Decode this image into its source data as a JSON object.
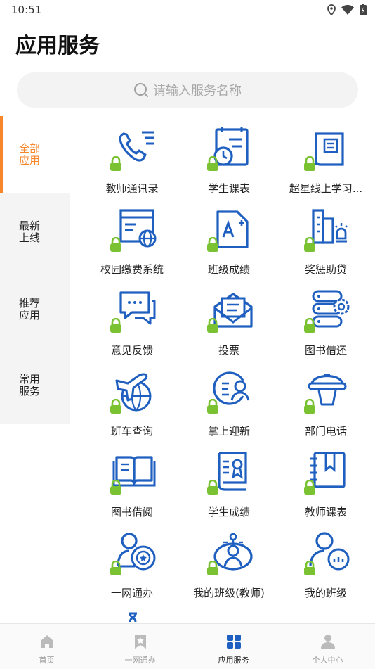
{
  "status": {
    "time": "10:51",
    "icons": [
      "location-icon",
      "wifi-icon",
      "battery-icon"
    ]
  },
  "page": {
    "title": "应用服务"
  },
  "search": {
    "placeholder": "请输入服务名称"
  },
  "sidebar": {
    "items": [
      {
        "label": "全部应用",
        "active": true
      },
      {
        "label": "最新上线",
        "active": false
      },
      {
        "label": "推荐应用",
        "active": false
      },
      {
        "label": "常用服务",
        "active": false
      }
    ]
  },
  "apps": [
    {
      "label": "教师通讯录",
      "icon": "phone-contacts-icon"
    },
    {
      "label": "学生课表",
      "icon": "calendar-clock-icon"
    },
    {
      "label": "超星线上学习...",
      "icon": "book-reader-icon"
    },
    {
      "label": "校园缴费系统",
      "icon": "web-payment-icon"
    },
    {
      "label": "班级成绩",
      "icon": "grade-document-icon"
    },
    {
      "label": "奖惩助贷",
      "icon": "award-building-icon"
    },
    {
      "label": "意见反馈",
      "icon": "chat-bubbles-icon"
    },
    {
      "label": "投票",
      "icon": "envelope-vote-icon"
    },
    {
      "label": "图书借还",
      "icon": "database-gear-icon"
    },
    {
      "label": "班车查询",
      "icon": "airplane-globe-icon"
    },
    {
      "label": "掌上迎新",
      "icon": "welcome-person-icon"
    },
    {
      "label": "部门电话",
      "icon": "desk-phone-icon"
    },
    {
      "label": "图书借阅",
      "icon": "open-book-icon"
    },
    {
      "label": "学生成绩",
      "icon": "certificate-scroll-icon"
    },
    {
      "label": "教师课表",
      "icon": "notebook-bookmark-icon"
    },
    {
      "label": "一网通办",
      "icon": "service-person-icon"
    },
    {
      "label": "我的班级(教师)",
      "icon": "class-teacher-icon"
    },
    {
      "label": "我的班级",
      "icon": "class-chat-icon"
    }
  ],
  "bottom_nav": [
    {
      "label": "首页",
      "icon": "home-icon",
      "active": false
    },
    {
      "label": "一网通办",
      "icon": "bookmark-star-icon",
      "active": false
    },
    {
      "label": "应用服务",
      "icon": "grid-apps-icon",
      "active": true
    },
    {
      "label": "个人中心",
      "icon": "person-icon",
      "active": false
    }
  ],
  "colors": {
    "accent": "#f7862b",
    "icon_blue": "#1e5fbf",
    "lock_green": "#7ac231",
    "nav_active": "#1e5fbf",
    "nav_inactive": "#bbbbbb"
  }
}
